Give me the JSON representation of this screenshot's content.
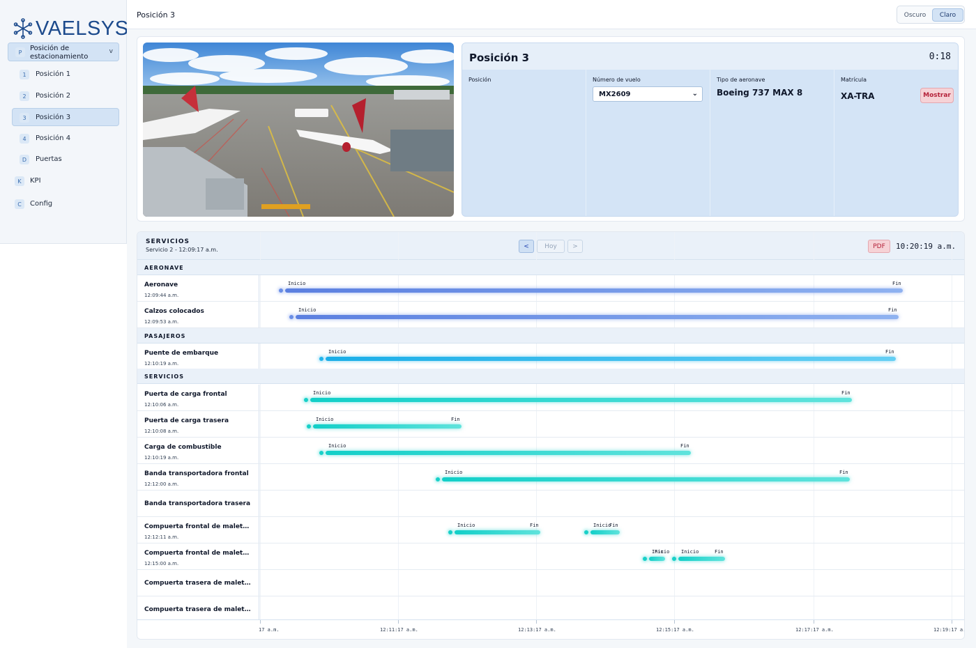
{
  "brand": {
    "name": "VAELSYS"
  },
  "sidebar": {
    "group": {
      "badge": "P",
      "label": "Posición de estacionamiento",
      "chevron": "v"
    },
    "items": [
      {
        "badge": "1",
        "label": "Posición 1"
      },
      {
        "badge": "2",
        "label": "Posición 2"
      },
      {
        "badge": "3",
        "label": "Posición 3",
        "active": true
      },
      {
        "badge": "4",
        "label": "Posición 4"
      },
      {
        "badge": "D",
        "label": "Puertas"
      }
    ],
    "root_items": [
      {
        "badge": "K",
        "label": "KPI"
      },
      {
        "badge": "C",
        "label": "Config"
      }
    ]
  },
  "header": {
    "title": "Posición 3",
    "theme_dark": "Oscuro",
    "theme_light": "Claro"
  },
  "info": {
    "title": "Posición 3",
    "timer": "0:18",
    "col_position": "Posición",
    "col_flight": "Número de vuelo",
    "flight_value": "MX2609",
    "col_aircraft": "Tipo de aeronave",
    "aircraft_value": "Boeing 737 MAX 8",
    "col_registration": "Matrícula",
    "registration_value": "XA-TRA",
    "show_button": "Mostrar"
  },
  "timeline": {
    "title": "SERVICIOS",
    "subtitle": "Servicio 2 - 12:09:17 a.m.",
    "prev": "<",
    "today": "Hoy",
    "next": ">",
    "pdf": "PDF",
    "clock": "10:20:19 a.m.",
    "start_label": "Inicio",
    "end_label": "Fin",
    "sections": [
      {
        "name": "AERONAVE",
        "rows": [
          {
            "name": "Aeronave",
            "time": "12:09:44 a.m."
          },
          {
            "name": "Calzos colocados",
            "time": "12:09:53 a.m."
          }
        ]
      },
      {
        "name": "PASAJEROS",
        "rows": [
          {
            "name": "Puente de embarque",
            "time": "12:10:19 a.m."
          }
        ]
      },
      {
        "name": "SERVICIOS",
        "rows": [
          {
            "name": "Puerta de carga frontal",
            "time": "12:10:06 a.m."
          },
          {
            "name": "Puerta de carga trasera",
            "time": "12:10:08 a.m."
          },
          {
            "name": "Carga de combustible",
            "time": "12:10:19 a.m."
          },
          {
            "name": "Banda transportadora frontal",
            "time": "12:12:00 a.m."
          },
          {
            "name": "Banda transportadora trasera",
            "time": ""
          },
          {
            "name": "Compuerta frontal de maletas ba...",
            "time": "12:12:11 a.m."
          },
          {
            "name": "Compuerta frontal de maletas su...",
            "time": "12:15:00 a.m."
          },
          {
            "name": "Compuerta trasera de maletas ba...",
            "time": ""
          },
          {
            "name": "Compuerta trasera de maletas su...",
            "time": ""
          }
        ]
      }
    ],
    "axis_labels": [
      "17 a.m.",
      "12:11:17 a.m.",
      "12:13:17 a.m.",
      "12:15:17 a.m.",
      "12:17:17 a.m.",
      "12:19:17 a."
    ]
  },
  "colors": {
    "accent": "#1c4a8c",
    "aeronave": "#5b7fe0",
    "pasajeros": "#1aaee8",
    "servicios": "#12cfc8",
    "danger": "#b4223a"
  }
}
